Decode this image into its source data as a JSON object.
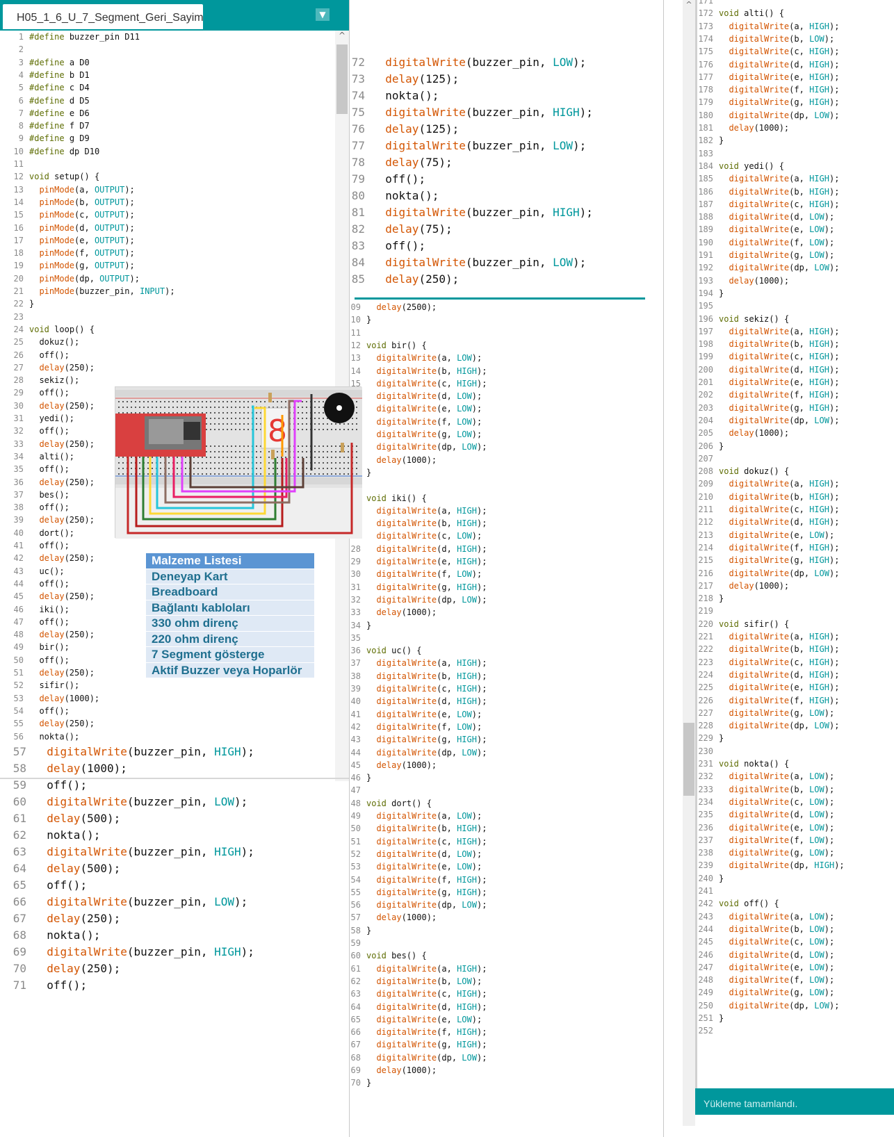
{
  "tab": {
    "title": "H05_1_6_U_7_Segment_Geri_Sayim",
    "menu_glyph": "▼"
  },
  "scroll_glyph": "^",
  "colors": {
    "accent": "#00979c",
    "keyword": "#5e6d03",
    "function": "#d35400",
    "constant": "#00979c"
  },
  "pane1_lines": [
    {
      "n": "1",
      "t": "#define buzzer_pin D11"
    },
    {
      "n": "2",
      "t": ""
    },
    {
      "n": "3",
      "t": "#define a D0"
    },
    {
      "n": "4",
      "t": "#define b D1"
    },
    {
      "n": "5",
      "t": "#define c D4"
    },
    {
      "n": "6",
      "t": "#define d D5"
    },
    {
      "n": "7",
      "t": "#define e D6"
    },
    {
      "n": "8",
      "t": "#define f D7"
    },
    {
      "n": "9",
      "t": "#define g D9"
    },
    {
      "n": "10",
      "t": "#define dp D10"
    },
    {
      "n": "11",
      "t": ""
    },
    {
      "n": "12",
      "t": "void setup() {"
    },
    {
      "n": "13",
      "t": "  pinMode(a, OUTPUT);"
    },
    {
      "n": "14",
      "t": "  pinMode(b, OUTPUT);"
    },
    {
      "n": "15",
      "t": "  pinMode(c, OUTPUT);"
    },
    {
      "n": "16",
      "t": "  pinMode(d, OUTPUT);"
    },
    {
      "n": "17",
      "t": "  pinMode(e, OUTPUT);"
    },
    {
      "n": "18",
      "t": "  pinMode(f, OUTPUT);"
    },
    {
      "n": "19",
      "t": "  pinMode(g, OUTPUT);"
    },
    {
      "n": "20",
      "t": "  pinMode(dp, OUTPUT);"
    },
    {
      "n": "21",
      "t": "  pinMode(buzzer_pin, INPUT);"
    },
    {
      "n": "22",
      "t": "}"
    },
    {
      "n": "23",
      "t": ""
    },
    {
      "n": "24",
      "t": "void loop() {"
    },
    {
      "n": "25",
      "t": "  dokuz();"
    },
    {
      "n": "26",
      "t": "  off();"
    },
    {
      "n": "27",
      "t": "  delay(250);"
    },
    {
      "n": "28",
      "t": "  sekiz();"
    },
    {
      "n": "29",
      "t": "  off();"
    },
    {
      "n": "30",
      "t": "  delay(250);"
    },
    {
      "n": "31",
      "t": "  yedi();"
    },
    {
      "n": "32",
      "t": "  off();"
    },
    {
      "n": "33",
      "t": "  delay(250);"
    },
    {
      "n": "34",
      "t": "  alti();"
    },
    {
      "n": "35",
      "t": "  off();"
    },
    {
      "n": "36",
      "t": "  delay(250);"
    },
    {
      "n": "37",
      "t": "  bes();"
    },
    {
      "n": "38",
      "t": "  off();"
    },
    {
      "n": "39",
      "t": "  delay(250);"
    },
    {
      "n": "40",
      "t": "  dort();"
    },
    {
      "n": "41",
      "t": "  off();"
    },
    {
      "n": "42",
      "t": "  delay(250);"
    },
    {
      "n": "43",
      "t": "  uc();"
    },
    {
      "n": "44",
      "t": "  off();"
    },
    {
      "n": "45",
      "t": "  delay(250);"
    },
    {
      "n": "46",
      "t": "  iki();"
    },
    {
      "n": "47",
      "t": "  off();"
    },
    {
      "n": "48",
      "t": "  delay(250);"
    },
    {
      "n": "49",
      "t": "  bir();"
    },
    {
      "n": "50",
      "t": "  off();"
    },
    {
      "n": "51",
      "t": "  delay(250);"
    },
    {
      "n": "52",
      "t": "  sifir();"
    },
    {
      "n": "53",
      "t": "  delay(1000);"
    },
    {
      "n": "54",
      "t": "  off();"
    },
    {
      "n": "55",
      "t": "  delay(250);"
    },
    {
      "n": "56",
      "t": "  nokta();"
    }
  ],
  "pane1_big_lines": [
    {
      "n": "57",
      "t": "  digitalWrite(buzzer_pin, HIGH);"
    },
    {
      "n": "58",
      "t": "  delay(1000);"
    },
    {
      "n": "59",
      "t": "  off();"
    },
    {
      "n": "60",
      "t": "  digitalWrite(buzzer_pin, LOW);"
    },
    {
      "n": "61",
      "t": "  delay(500);"
    },
    {
      "n": "62",
      "t": "  nokta();"
    },
    {
      "n": "63",
      "t": "  digitalWrite(buzzer_pin, HIGH);"
    },
    {
      "n": "64",
      "t": "  delay(500);"
    },
    {
      "n": "65",
      "t": "  off();"
    },
    {
      "n": "66",
      "t": "  digitalWrite(buzzer_pin, LOW);"
    },
    {
      "n": "67",
      "t": "  delay(250);"
    },
    {
      "n": "68",
      "t": "  nokta();"
    },
    {
      "n": "69",
      "t": "  digitalWrite(buzzer_pin, HIGH);"
    },
    {
      "n": "70",
      "t": "  delay(250);"
    },
    {
      "n": "71",
      "t": "  off();"
    }
  ],
  "pane2_big_lines": [
    {
      "n": "72",
      "t": "  digitalWrite(buzzer_pin, LOW);"
    },
    {
      "n": "73",
      "t": "  delay(125);"
    },
    {
      "n": "74",
      "t": "  nokta();"
    },
    {
      "n": "75",
      "t": "  digitalWrite(buzzer_pin, HIGH);"
    },
    {
      "n": "76",
      "t": "  delay(125);"
    },
    {
      "n": "77",
      "t": "  digitalWrite(buzzer_pin, LOW);"
    },
    {
      "n": "78",
      "t": "  delay(75);"
    },
    {
      "n": "79",
      "t": "  off();"
    },
    {
      "n": "80",
      "t": "  nokta();"
    },
    {
      "n": "81",
      "t": "  digitalWrite(buzzer_pin, HIGH);"
    },
    {
      "n": "82",
      "t": "  delay(75);"
    },
    {
      "n": "83",
      "t": "  off();"
    },
    {
      "n": "84",
      "t": "  digitalWrite(buzzer_pin, LOW);"
    },
    {
      "n": "85",
      "t": "  delay(250);"
    }
  ],
  "pane2_lines": [
    {
      "n": "109",
      "t": "  delay(2500);"
    },
    {
      "n": "110",
      "t": "}"
    },
    {
      "n": "111",
      "t": ""
    },
    {
      "n": "112",
      "t": "void bir() {"
    },
    {
      "n": "113",
      "t": "  digitalWrite(a, LOW);"
    },
    {
      "n": "114",
      "t": "  digitalWrite(b, HIGH);"
    },
    {
      "n": "115",
      "t": "  digitalWrite(c, HIGH);"
    },
    {
      "n": "116",
      "t": "  digitalWrite(d, LOW);"
    },
    {
      "n": "117",
      "t": "  digitalWrite(e, LOW);"
    },
    {
      "n": "118",
      "t": "  digitalWrite(f, LOW);"
    },
    {
      "n": "119",
      "t": "  digitalWrite(g, LOW);"
    },
    {
      "n": "120",
      "t": "  digitalWrite(dp, LOW);"
    },
    {
      "n": "121",
      "t": "  delay(1000);"
    },
    {
      "n": "122",
      "t": "}"
    },
    {
      "n": "123",
      "t": ""
    },
    {
      "n": "124",
      "t": "void iki() {"
    },
    {
      "n": "125",
      "t": "  digitalWrite(a, HIGH);"
    },
    {
      "n": "126",
      "t": "  digitalWrite(b, HIGH);"
    },
    {
      "n": "127",
      "t": "  digitalWrite(c, LOW);"
    },
    {
      "n": "128",
      "t": "  digitalWrite(d, HIGH);"
    },
    {
      "n": "129",
      "t": "  digitalWrite(e, HIGH);"
    },
    {
      "n": "130",
      "t": "  digitalWrite(f, LOW);"
    },
    {
      "n": "131",
      "t": "  digitalWrite(g, HIGH);"
    },
    {
      "n": "132",
      "t": "  digitalWrite(dp, LOW);"
    },
    {
      "n": "133",
      "t": "  delay(1000);"
    },
    {
      "n": "134",
      "t": "}"
    },
    {
      "n": "135",
      "t": ""
    },
    {
      "n": "136",
      "t": "void uc() {"
    },
    {
      "n": "137",
      "t": "  digitalWrite(a, HIGH);"
    },
    {
      "n": "138",
      "t": "  digitalWrite(b, HIGH);"
    },
    {
      "n": "139",
      "t": "  digitalWrite(c, HIGH);"
    },
    {
      "n": "140",
      "t": "  digitalWrite(d, HIGH);"
    },
    {
      "n": "141",
      "t": "  digitalWrite(e, LOW);"
    },
    {
      "n": "142",
      "t": "  digitalWrite(f, LOW);"
    },
    {
      "n": "143",
      "t": "  digitalWrite(g, HIGH);"
    },
    {
      "n": "144",
      "t": "  digitalWrite(dp, LOW);"
    },
    {
      "n": "145",
      "t": "  delay(1000);"
    },
    {
      "n": "146",
      "t": "}"
    },
    {
      "n": "147",
      "t": ""
    },
    {
      "n": "148",
      "t": "void dort() {"
    },
    {
      "n": "149",
      "t": "  digitalWrite(a, LOW);"
    },
    {
      "n": "150",
      "t": "  digitalWrite(b, HIGH);"
    },
    {
      "n": "151",
      "t": "  digitalWrite(c, HIGH);"
    },
    {
      "n": "152",
      "t": "  digitalWrite(d, LOW);"
    },
    {
      "n": "153",
      "t": "  digitalWrite(e, LOW);"
    },
    {
      "n": "154",
      "t": "  digitalWrite(f, HIGH);"
    },
    {
      "n": "155",
      "t": "  digitalWrite(g, HIGH);"
    },
    {
      "n": "156",
      "t": "  digitalWrite(dp, LOW);"
    },
    {
      "n": "157",
      "t": "  delay(1000);"
    },
    {
      "n": "158",
      "t": "}"
    },
    {
      "n": "159",
      "t": ""
    },
    {
      "n": "160",
      "t": "void bes() {"
    },
    {
      "n": "161",
      "t": "  digitalWrite(a, HIGH);"
    },
    {
      "n": "162",
      "t": "  digitalWrite(b, LOW);"
    },
    {
      "n": "163",
      "t": "  digitalWrite(c, HIGH);"
    },
    {
      "n": "164",
      "t": "  digitalWrite(d, HIGH);"
    },
    {
      "n": "165",
      "t": "  digitalWrite(e, LOW);"
    },
    {
      "n": "166",
      "t": "  digitalWrite(f, HIGH);"
    },
    {
      "n": "167",
      "t": "  digitalWrite(g, HIGH);"
    },
    {
      "n": "168",
      "t": "  digitalWrite(dp, LOW);"
    },
    {
      "n": "169",
      "t": "  delay(1000);"
    },
    {
      "n": "170",
      "t": "}"
    }
  ],
  "pane3_lines": [
    {
      "n": "171",
      "t": ""
    },
    {
      "n": "172",
      "t": "void alti() {"
    },
    {
      "n": "173",
      "t": "  digitalWrite(a, HIGH);"
    },
    {
      "n": "174",
      "t": "  digitalWrite(b, LOW);"
    },
    {
      "n": "175",
      "t": "  digitalWrite(c, HIGH);"
    },
    {
      "n": "176",
      "t": "  digitalWrite(d, HIGH);"
    },
    {
      "n": "177",
      "t": "  digitalWrite(e, HIGH);"
    },
    {
      "n": "178",
      "t": "  digitalWrite(f, HIGH);"
    },
    {
      "n": "179",
      "t": "  digitalWrite(g, HIGH);"
    },
    {
      "n": "180",
      "t": "  digitalWrite(dp, LOW);"
    },
    {
      "n": "181",
      "t": "  delay(1000);"
    },
    {
      "n": "182",
      "t": "}"
    },
    {
      "n": "183",
      "t": ""
    },
    {
      "n": "184",
      "t": "void yedi() {"
    },
    {
      "n": "185",
      "t": "  digitalWrite(a, HIGH);"
    },
    {
      "n": "186",
      "t": "  digitalWrite(b, HIGH);"
    },
    {
      "n": "187",
      "t": "  digitalWrite(c, HIGH);"
    },
    {
      "n": "188",
      "t": "  digitalWrite(d, LOW);"
    },
    {
      "n": "189",
      "t": "  digitalWrite(e, LOW);"
    },
    {
      "n": "190",
      "t": "  digitalWrite(f, LOW);"
    },
    {
      "n": "191",
      "t": "  digitalWrite(g, LOW);"
    },
    {
      "n": "192",
      "t": "  digitalWrite(dp, LOW);"
    },
    {
      "n": "193",
      "t": "  delay(1000);"
    },
    {
      "n": "194",
      "t": "}"
    },
    {
      "n": "195",
      "t": ""
    },
    {
      "n": "196",
      "t": "void sekiz() {"
    },
    {
      "n": "197",
      "t": "  digitalWrite(a, HIGH);"
    },
    {
      "n": "198",
      "t": "  digitalWrite(b, HIGH);"
    },
    {
      "n": "199",
      "t": "  digitalWrite(c, HIGH);"
    },
    {
      "n": "200",
      "t": "  digitalWrite(d, HIGH);"
    },
    {
      "n": "201",
      "t": "  digitalWrite(e, HIGH);"
    },
    {
      "n": "202",
      "t": "  digitalWrite(f, HIGH);"
    },
    {
      "n": "203",
      "t": "  digitalWrite(g, HIGH);"
    },
    {
      "n": "204",
      "t": "  digitalWrite(dp, LOW);"
    },
    {
      "n": "205",
      "t": "  delay(1000);"
    },
    {
      "n": "206",
      "t": "}"
    },
    {
      "n": "207",
      "t": ""
    },
    {
      "n": "208",
      "t": "void dokuz() {"
    },
    {
      "n": "209",
      "t": "  digitalWrite(a, HIGH);"
    },
    {
      "n": "210",
      "t": "  digitalWrite(b, HIGH);"
    },
    {
      "n": "211",
      "t": "  digitalWrite(c, HIGH);"
    },
    {
      "n": "212",
      "t": "  digitalWrite(d, HIGH);"
    },
    {
      "n": "213",
      "t": "  digitalWrite(e, LOW);"
    },
    {
      "n": "214",
      "t": "  digitalWrite(f, HIGH);"
    },
    {
      "n": "215",
      "t": "  digitalWrite(g, HIGH);"
    },
    {
      "n": "216",
      "t": "  digitalWrite(dp, LOW);"
    },
    {
      "n": "217",
      "t": "  delay(1000);"
    },
    {
      "n": "218",
      "t": "}"
    },
    {
      "n": "219",
      "t": ""
    },
    {
      "n": "220",
      "t": "void sifir() {"
    },
    {
      "n": "221",
      "t": "  digitalWrite(a, HIGH);"
    },
    {
      "n": "222",
      "t": "  digitalWrite(b, HIGH);"
    },
    {
      "n": "223",
      "t": "  digitalWrite(c, HIGH);"
    },
    {
      "n": "224",
      "t": "  digitalWrite(d, HIGH);"
    },
    {
      "n": "225",
      "t": "  digitalWrite(e, HIGH);"
    },
    {
      "n": "226",
      "t": "  digitalWrite(f, HIGH);"
    },
    {
      "n": "227",
      "t": "  digitalWrite(g, LOW);"
    },
    {
      "n": "228",
      "t": "  digitalWrite(dp, LOW);"
    },
    {
      "n": "229",
      "t": "}"
    },
    {
      "n": "230",
      "t": ""
    },
    {
      "n": "231",
      "t": "void nokta() {"
    },
    {
      "n": "232",
      "t": "  digitalWrite(a, LOW);"
    },
    {
      "n": "233",
      "t": "  digitalWrite(b, LOW);"
    },
    {
      "n": "234",
      "t": "  digitalWrite(c, LOW);"
    },
    {
      "n": "235",
      "t": "  digitalWrite(d, LOW);"
    },
    {
      "n": "236",
      "t": "  digitalWrite(e, LOW);"
    },
    {
      "n": "237",
      "t": "  digitalWrite(f, LOW);"
    },
    {
      "n": "238",
      "t": "  digitalWrite(g, LOW);"
    },
    {
      "n": "239",
      "t": "  digitalWrite(dp, HIGH);"
    },
    {
      "n": "240",
      "t": "}"
    },
    {
      "n": "241",
      "t": ""
    },
    {
      "n": "242",
      "t": "void off() {"
    },
    {
      "n": "243",
      "t": "  digitalWrite(a, LOW);"
    },
    {
      "n": "244",
      "t": "  digitalWrite(b, LOW);"
    },
    {
      "n": "245",
      "t": "  digitalWrite(c, LOW);"
    },
    {
      "n": "246",
      "t": "  digitalWrite(d, LOW);"
    },
    {
      "n": "247",
      "t": "  digitalWrite(e, LOW);"
    },
    {
      "n": "248",
      "t": "  digitalWrite(f, LOW);"
    },
    {
      "n": "249",
      "t": "  digitalWrite(g, LOW);"
    },
    {
      "n": "250",
      "t": "  digitalWrite(dp, LOW);"
    },
    {
      "n": "251",
      "t": "}"
    },
    {
      "n": "252",
      "t": ""
    }
  ],
  "materials": {
    "header": "Malzeme Listesi",
    "items": [
      "Deneyap Kart",
      "Breadboard",
      "Bağlantı kabloları",
      "330 ohm direnç",
      "220 ohm direnç",
      "7 Segment gösterge",
      "Aktif Buzzer veya Hoparlör"
    ]
  },
  "status": {
    "text": "Yükleme tamamlandı."
  }
}
